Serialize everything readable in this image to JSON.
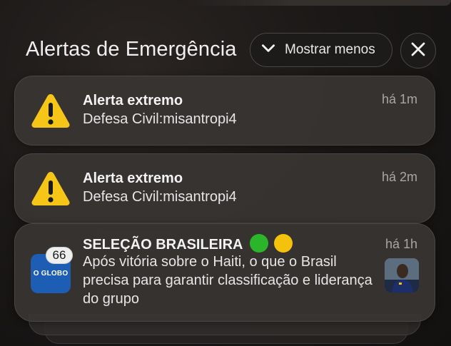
{
  "header": {
    "title": "Alertas de Emergência",
    "show_less_label": "Mostrar menos"
  },
  "notifications": [
    {
      "title": "Alerta extremo",
      "body": "Defesa Civil:misantropi4",
      "time": "há 1m",
      "icon": "warning-triangle-icon"
    },
    {
      "title": "Alerta extremo",
      "body": "Defesa Civil:misantropi4",
      "time": "há 2m",
      "icon": "warning-triangle-icon"
    },
    {
      "title": "SELEÇÃO BRASILEIRA",
      "body": "Após vitória sobre o Haiti, o que o Brasil precisa para garantir classificação e liderança do grupo",
      "time": "há 1h",
      "app_icon_text": "O GLOBO",
      "badge_count": "66",
      "emoji_dots": [
        "green-circle",
        "yellow-circle"
      ],
      "colors": {
        "green": "#2bb52b",
        "yellow": "#f4c20d"
      }
    }
  ],
  "colors": {
    "warning_yellow": "#f5c518",
    "card_bg": "#383533",
    "globo_blue": "#1d5db4"
  }
}
